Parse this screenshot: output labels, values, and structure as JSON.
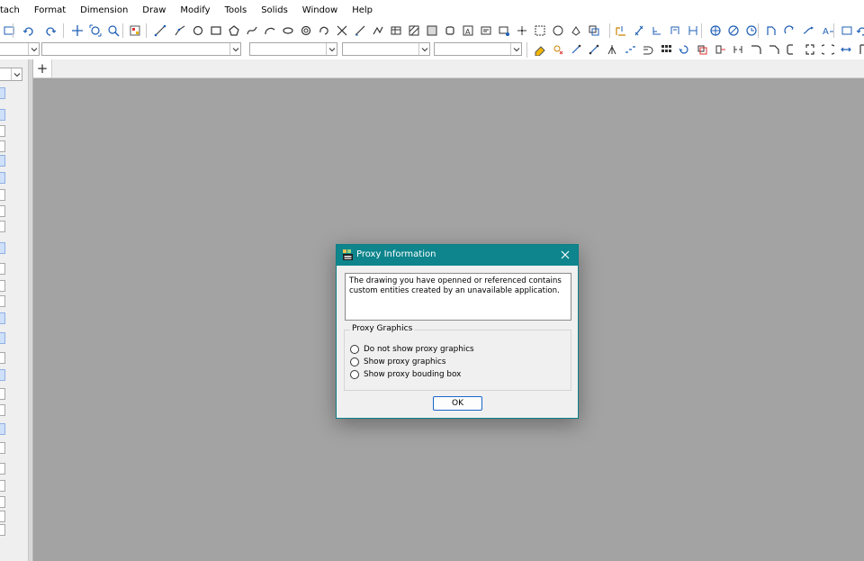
{
  "menu": {
    "items": [
      "tach",
      "Format",
      "Dimension",
      "Draw",
      "Modify",
      "Tools",
      "Solids",
      "Window",
      "Help"
    ]
  },
  "toolbar_row1": {
    "icons": [
      "layer-icon",
      "undo-icon",
      "redo-icon",
      "pan-icon",
      "zoom-window-icon",
      "zoom-realtime-icon",
      "properties-icon",
      "line-icon",
      "polyline-icon",
      "circle-icon",
      "rectangle-icon",
      "polygon-icon",
      "spline-icon",
      "arc-icon",
      "ellipse-icon",
      "donut-icon",
      "revcloud-icon",
      "construction-line-icon",
      "ray-icon",
      "multiline-icon",
      "table-icon",
      "hatch-icon",
      "gradient-icon",
      "region-icon",
      "text-icon",
      "mtext-icon",
      "block-insert-icon",
      "point-icon",
      "block-define-icon",
      "boundary-icon",
      "wipeout-icon",
      "move-icon",
      "dimension-linear-icon",
      "dimension-aligned-icon",
      "dimension-angular-icon",
      "dimension-radius-icon",
      "dimension-diameter-icon",
      "snap-center-icon",
      "snap-quadrant-icon",
      "snap-tangent-icon",
      "snap-perpendicular-icon",
      "snap-endpoint-icon",
      "snap-intersection-icon",
      "text-style-icon"
    ]
  },
  "toolbar_row2": {
    "combos": [
      "",
      "",
      "",
      "",
      ""
    ],
    "icons": [
      "erase-icon",
      "copy-icon",
      "mirror-icon",
      "offset-icon",
      "array-icon",
      "rotate-icon",
      "scale-icon",
      "stretch-icon",
      "trim-icon",
      "extend-icon",
      "break-icon",
      "join-icon",
      "chamfer-icon",
      "fillet-icon",
      "explode-icon"
    ]
  },
  "tabs": {
    "new_tab_label": "+"
  },
  "dialog": {
    "title": "Proxy Information",
    "message": "The drawing you have openned or referenced contains custom entities created by an unavailable application.",
    "group_label": "Proxy Graphics",
    "options": [
      "Do not show proxy graphics",
      "Show proxy graphics",
      "Show proxy bouding box"
    ],
    "ok_label": "OK",
    "colors": {
      "title_bar": "#0e858d",
      "button_border": "#1a66c8"
    }
  }
}
